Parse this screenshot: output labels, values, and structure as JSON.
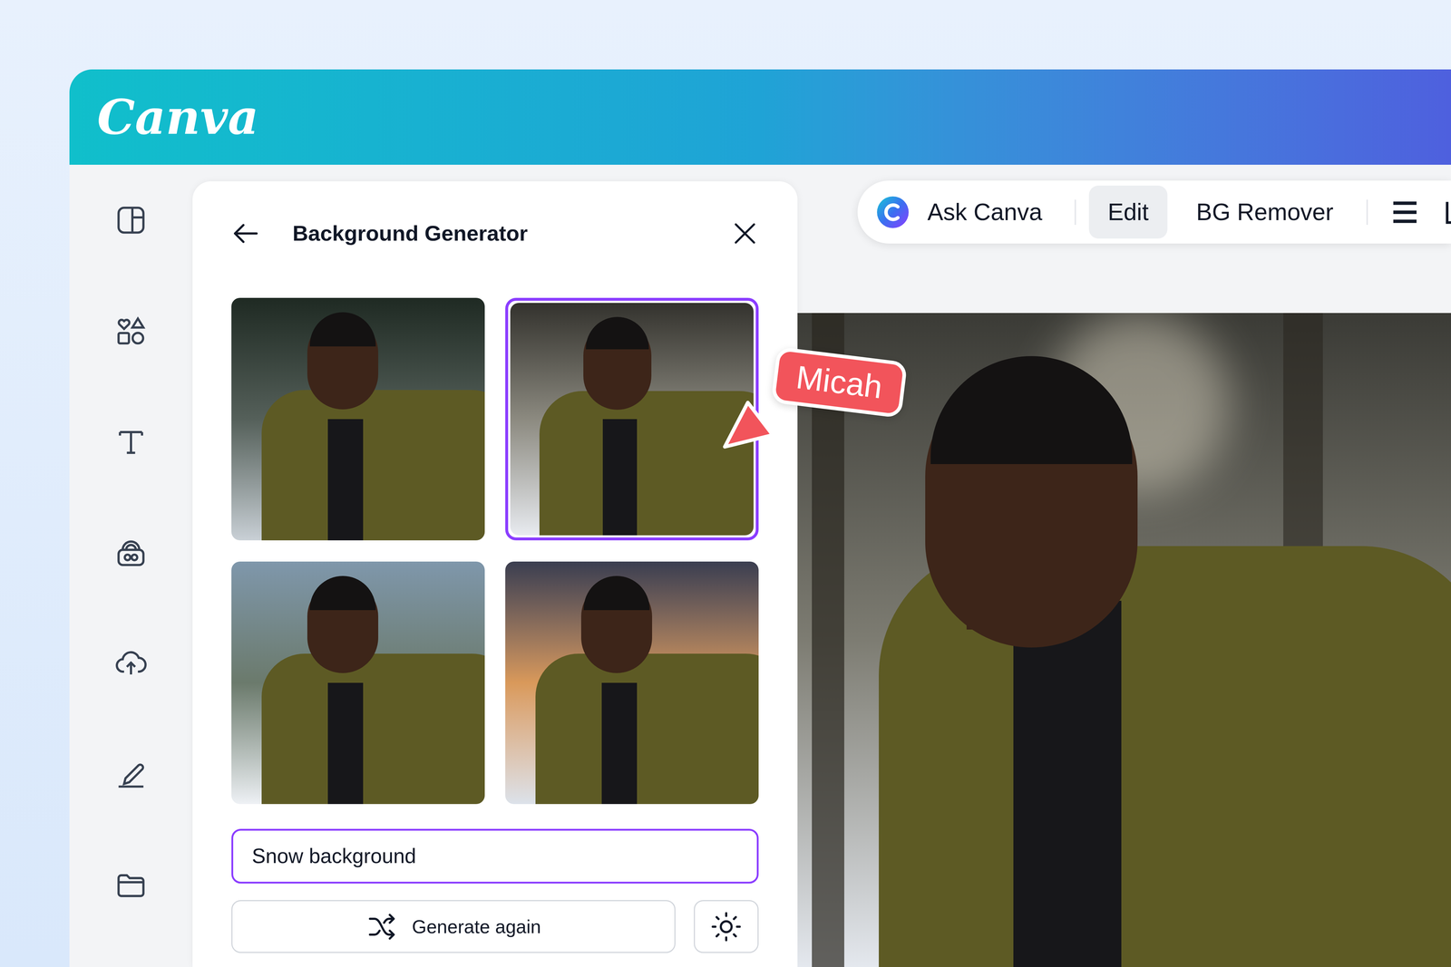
{
  "app": {
    "logo": "Canva"
  },
  "panel": {
    "title": "Background Generator",
    "results": [
      {
        "selected": false
      },
      {
        "selected": true
      },
      {
        "selected": false
      },
      {
        "selected": false
      }
    ],
    "prompt": {
      "value": "Snow background"
    },
    "generate_button": "Generate again"
  },
  "toolbar": {
    "items": [
      {
        "label": "Ask Canva",
        "selected": false
      },
      {
        "label": "Edit",
        "selected": true
      },
      {
        "label": "BG Remover",
        "selected": false
      }
    ]
  },
  "cursor": {
    "label": "Micah",
    "color": "#f2545b"
  }
}
